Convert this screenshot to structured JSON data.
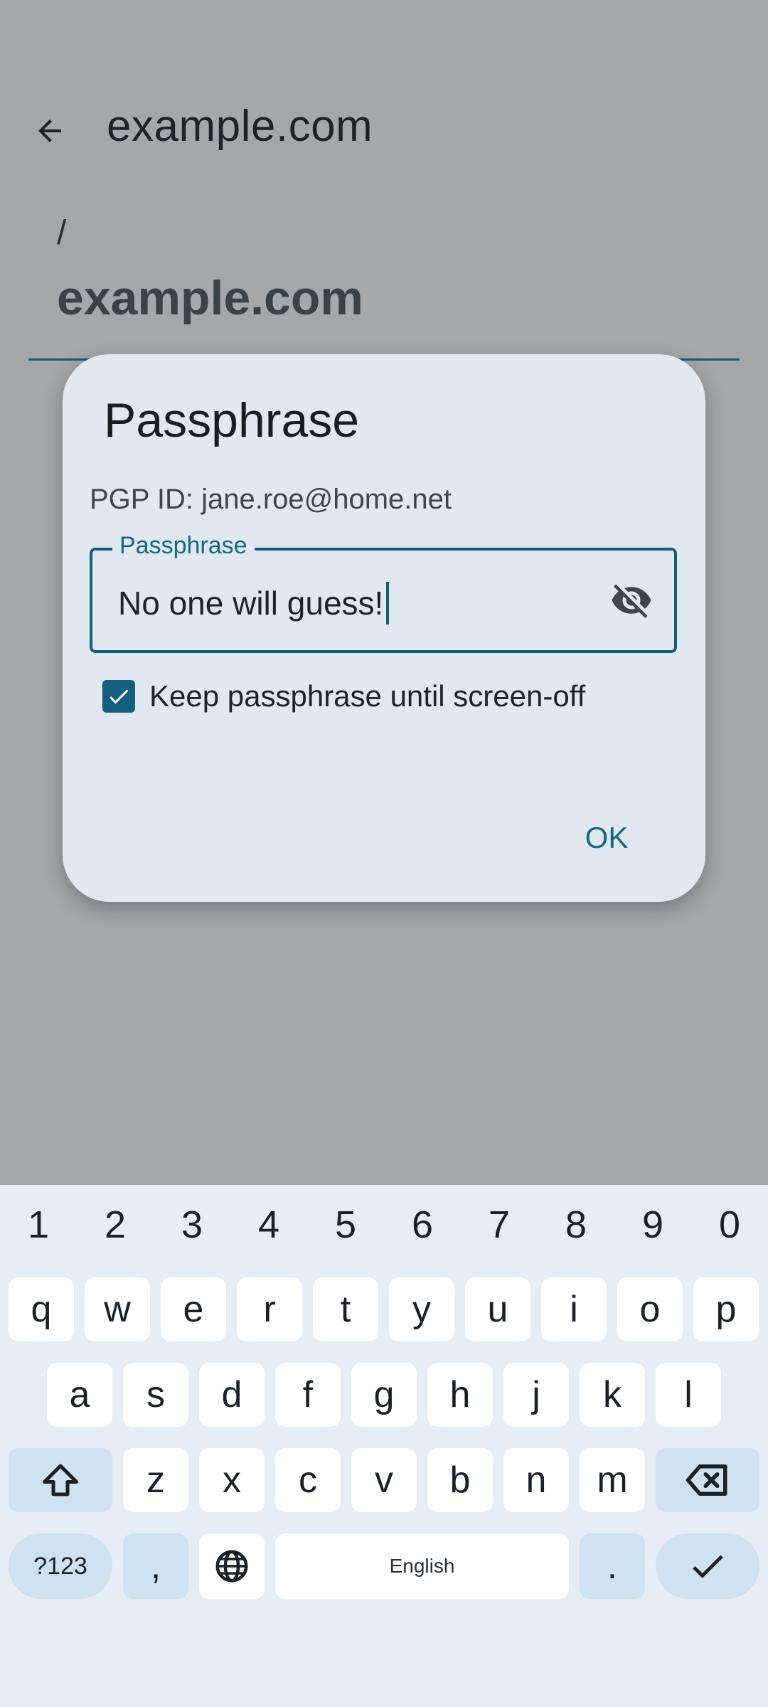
{
  "appbar": {
    "title": "example.com"
  },
  "path": {
    "separator": "/",
    "name": "example.com"
  },
  "dialog": {
    "title": "Passphrase",
    "pgp_id": "PGP ID: jane.roe@home.net",
    "field_label": "Passphrase",
    "field_value": "No one will guess!",
    "checkbox_label": "Keep passphrase until screen-off",
    "checkbox_checked": true,
    "ok_label": "OK"
  },
  "keyboard": {
    "numbers": [
      "1",
      "2",
      "3",
      "4",
      "5",
      "6",
      "7",
      "8",
      "9",
      "0"
    ],
    "row1": [
      "q",
      "w",
      "e",
      "r",
      "t",
      "y",
      "u",
      "i",
      "o",
      "p"
    ],
    "row2": [
      "a",
      "s",
      "d",
      "f",
      "g",
      "h",
      "j",
      "k",
      "l"
    ],
    "row3": [
      "z",
      "x",
      "c",
      "v",
      "b",
      "n",
      "m"
    ],
    "symbols_label": "?123",
    "comma": ",",
    "space_label": "English",
    "period": "."
  },
  "colors": {
    "accent": "#135f7e",
    "scrim": "#a4a8ab",
    "dialog_bg": "#e1e8ef",
    "keyboard_bg": "#e6edf4"
  },
  "icons": [
    "arrow-back-icon",
    "visibility-off-icon",
    "checkmark-icon",
    "shift-icon",
    "backspace-icon",
    "globe-icon",
    "done-icon"
  ]
}
